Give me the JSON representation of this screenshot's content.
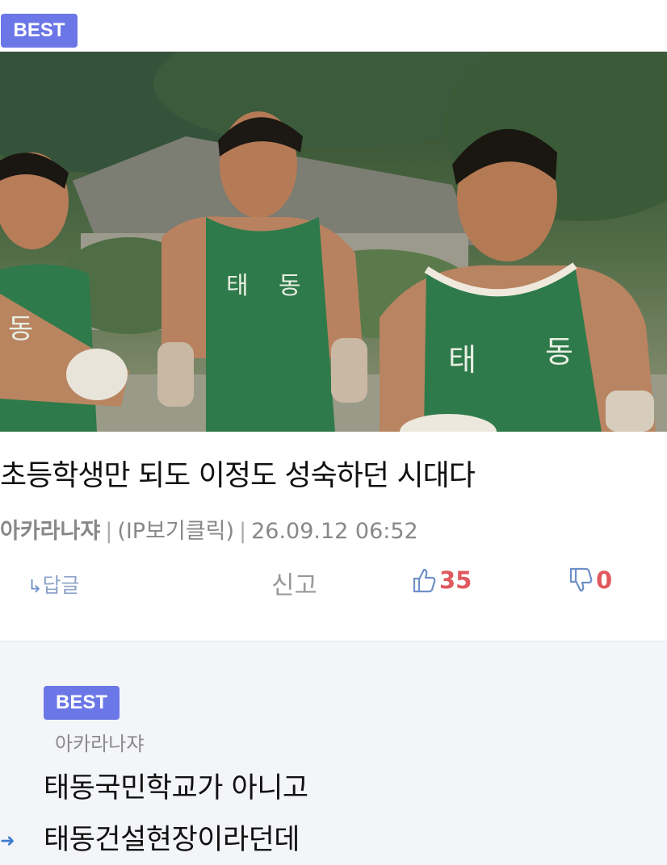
{
  "post": {
    "badge": "BEST",
    "title": "초등학생만 되도 이정도 성숙하던 시대다",
    "author": "아카라나쟈",
    "ip_label": "(IP보기클릭)",
    "separator": "|",
    "datetime": "26.09.12 06:52",
    "photo_jersey_text": [
      "태",
      "동"
    ]
  },
  "actions": {
    "reply_label": "답글",
    "reply_arrow": "↳",
    "report_label": "신고",
    "like_count": "35",
    "dislike_count": "0"
  },
  "comment": {
    "badge": "BEST",
    "author": "아카라나쟈",
    "lines": [
      "태동국민학교가 아니고",
      "태동건설현장이라던데"
    ]
  },
  "colors": {
    "badge": "#6b77e6",
    "like": "#e0595e",
    "jersey": "#2f7a4a"
  }
}
